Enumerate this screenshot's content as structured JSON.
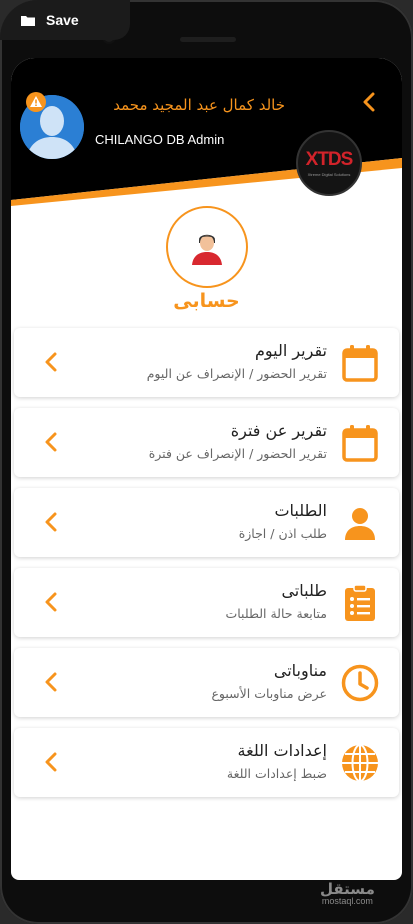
{
  "window": {
    "save_label": "Save"
  },
  "header": {
    "user_name": "خالد كمال عبد المجيد  محمد",
    "user_role": "CHILANGO DB Admin",
    "logo_text": "XTDS",
    "logo_subtext": "Xtreme Digital Solutions"
  },
  "profile": {
    "title": "حسابى"
  },
  "menu": [
    {
      "title": "تقرير اليوم",
      "subtitle": "تقرير الحضور / الإنصراف عن اليوم",
      "icon": "calendar-icon"
    },
    {
      "title": "تقرير عن فترة",
      "subtitle": "تقرير الحضور / الإنصراف عن فترة",
      "icon": "calendar-icon"
    },
    {
      "title": "الطلبات",
      "subtitle": "طلب اذن / اجازة",
      "icon": "person-icon"
    },
    {
      "title": "طلباتى",
      "subtitle": "متابعة حالة الطلبات",
      "icon": "clipboard-list-icon"
    },
    {
      "title": "مناوباتى",
      "subtitle": "عرض مناوبات الأسبوع",
      "icon": "clock-icon"
    },
    {
      "title": "إعدادات اللغة",
      "subtitle": "ضبط إعدادات اللغة",
      "icon": "globe-icon"
    }
  ],
  "watermark": {
    "line1": "مستقل",
    "line2": "mostaql.com"
  },
  "colors": {
    "accent": "#f7941d",
    "header_bg": "#000000",
    "surface": "#ffffff"
  }
}
